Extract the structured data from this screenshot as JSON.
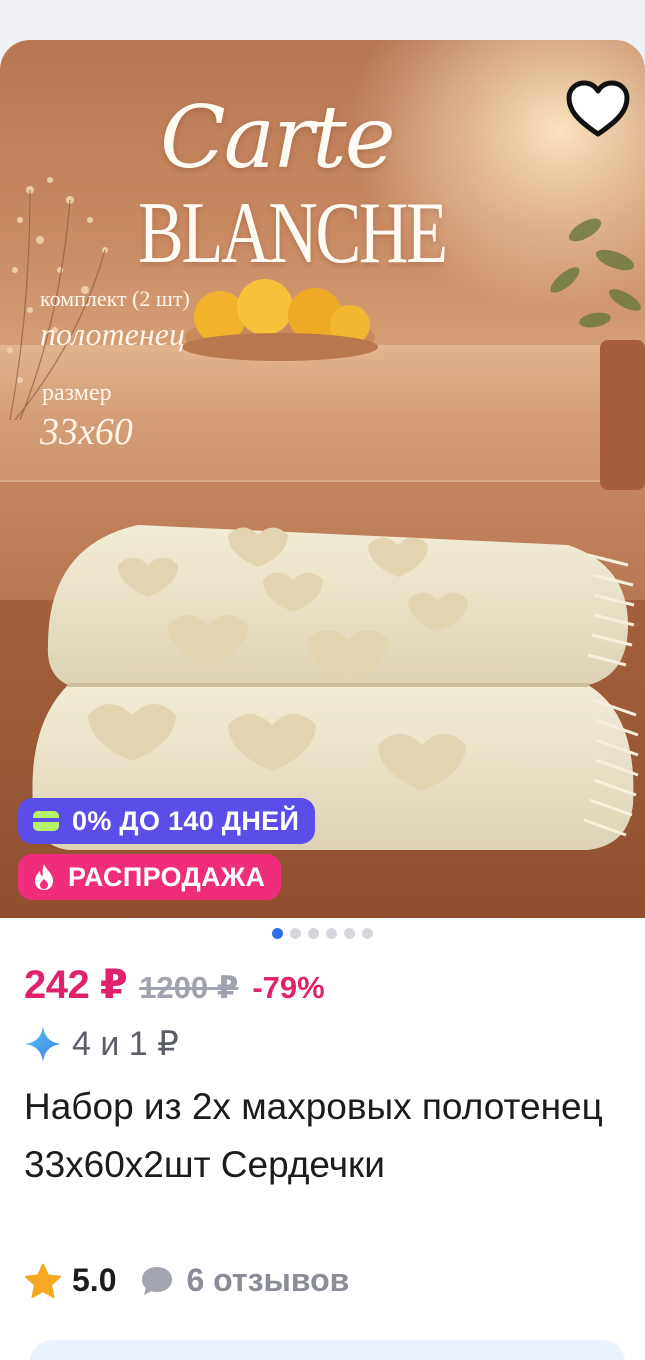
{
  "product_image": {
    "brand_script": "Carte",
    "brand_caps": "BLANCHE",
    "set_line": "комплект (2 шт)",
    "set_name": "полотенец",
    "size_label": "размер",
    "size_value": "33х60"
  },
  "favorite": {
    "icon": "heart-outline-icon"
  },
  "badges": {
    "installment": {
      "icon": "card-icon",
      "label": "0% ДО 140 ДНЕЙ",
      "color": "#5b4ee8"
    },
    "sale": {
      "icon": "fire-icon",
      "label": "РАСПРОДАЖА",
      "color": "#ef2d7a"
    }
  },
  "carousel": {
    "total": 6,
    "active": 0
  },
  "pricing": {
    "price": "242 ₽",
    "old_price": "1200 ₽",
    "discount": "-79%",
    "accent_color": "#e0226e"
  },
  "bonus": {
    "icon": "sparkle-icon",
    "text": "4 и 1 ₽"
  },
  "product": {
    "title": "Набор из 2х махровых полотенец 33х60х2шт Сердечки"
  },
  "rating": {
    "icon": "star-icon",
    "value": "5.0",
    "reviews_icon": "comment-icon",
    "reviews": "6 отзывов"
  }
}
